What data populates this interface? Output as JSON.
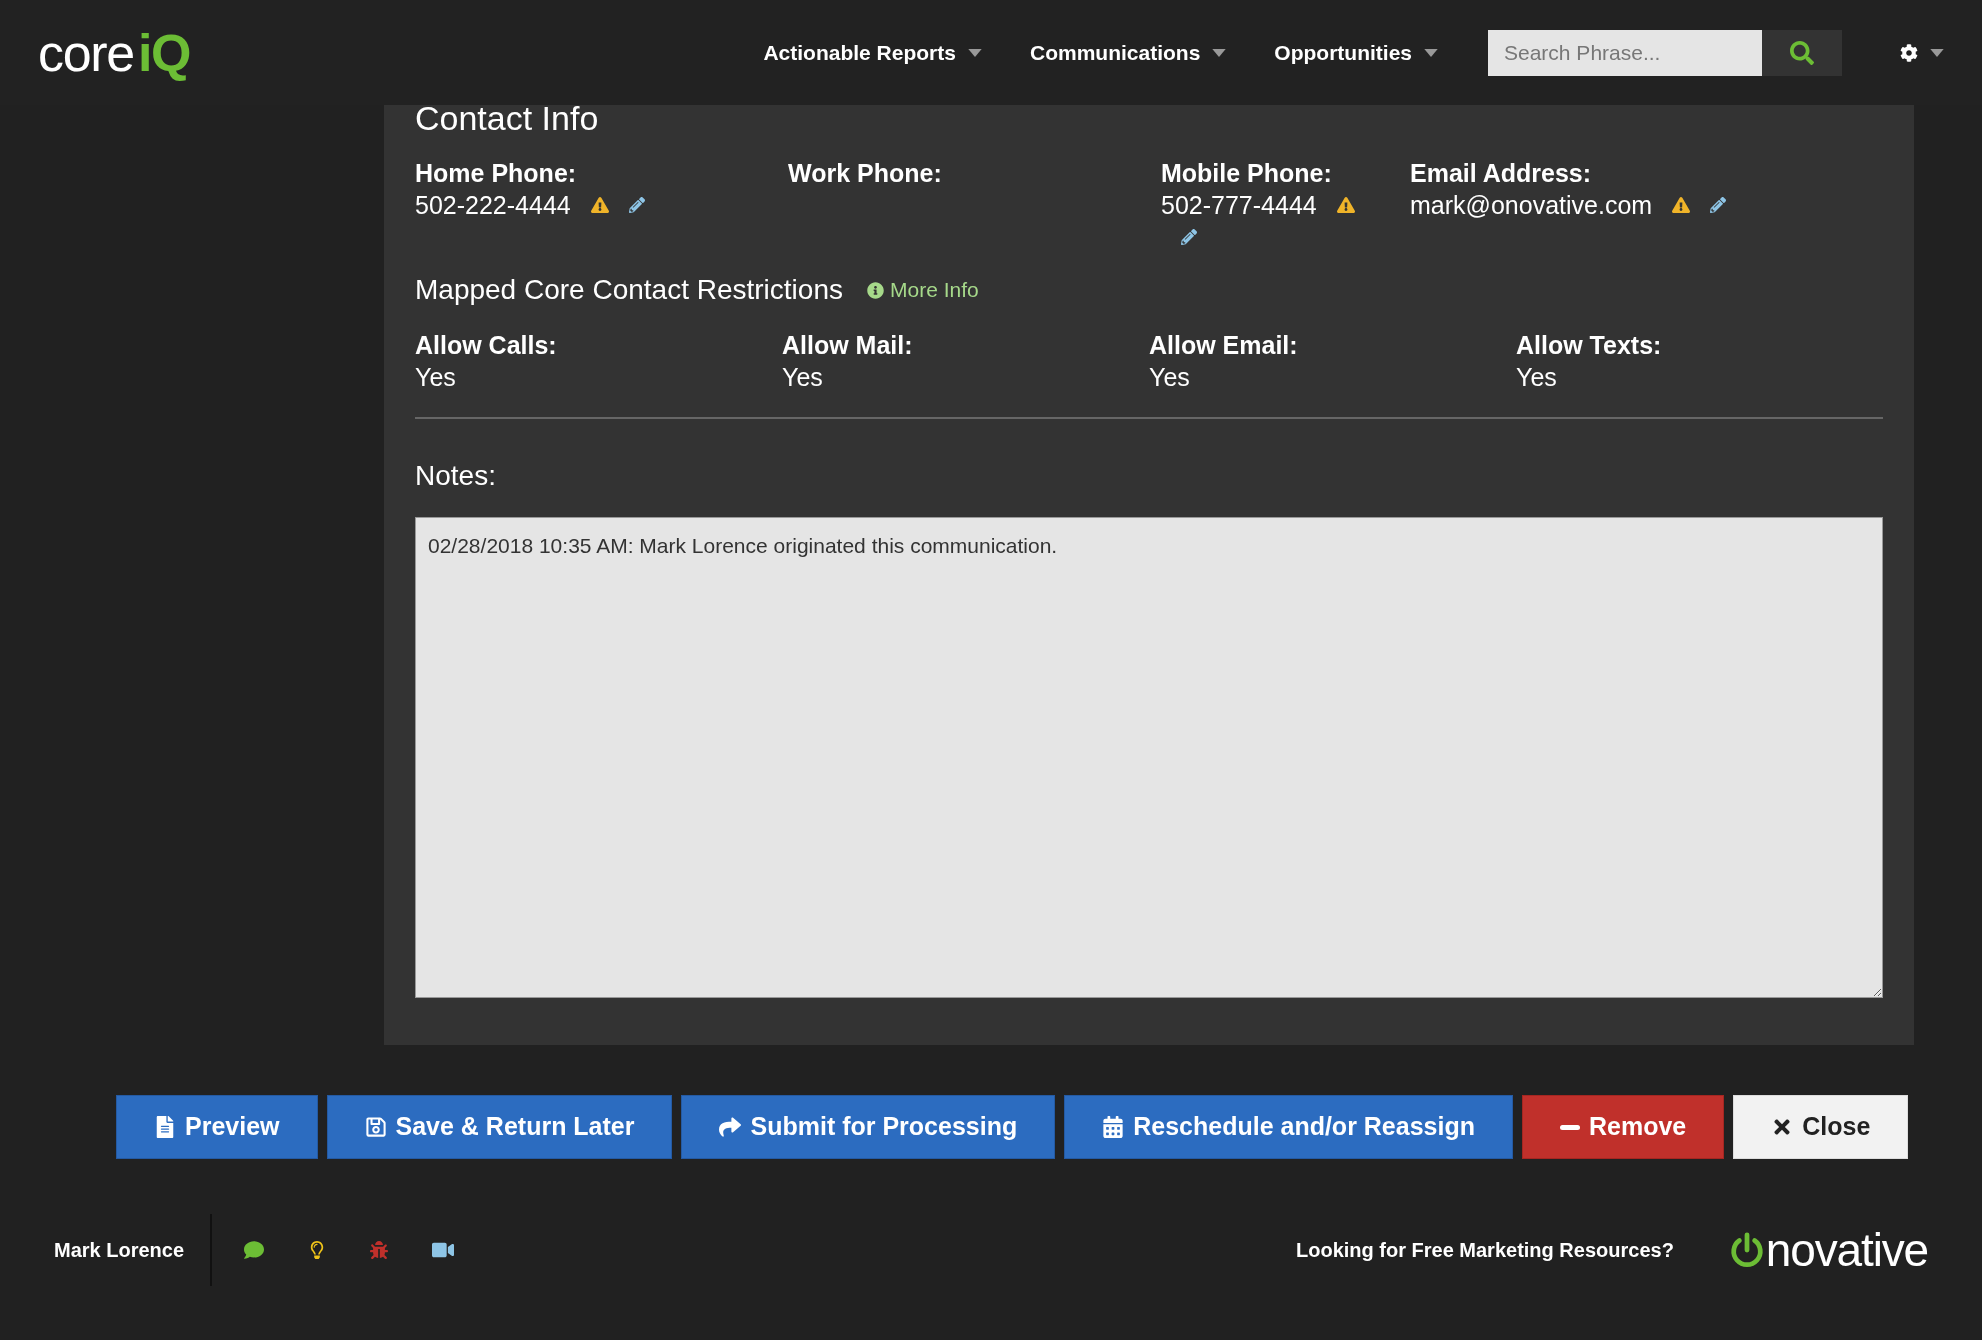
{
  "header": {
    "logo": {
      "core": "core",
      "iq": "iQ"
    },
    "nav": [
      {
        "label": "Actionable Reports"
      },
      {
        "label": "Communications"
      },
      {
        "label": "Opportunities"
      }
    ],
    "search": {
      "placeholder": "Search Phrase..."
    }
  },
  "contact_info": {
    "title": "Contact Info",
    "fields": [
      {
        "label": "Home Phone:",
        "value": "502-222-4444",
        "warning": true,
        "editable": true
      },
      {
        "label": "Work Phone:",
        "warning": false,
        "editable": false
      },
      {
        "label": "Mobile Phone:",
        "value": "502-777-4444",
        "warning": true,
        "editable": true
      },
      {
        "label": "Email Address:",
        "value": "mark@onovative.com",
        "warning": true,
        "editable": true
      }
    ],
    "restrictions_title": "Mapped Core Contact Restrictions",
    "more_info": "More Info",
    "restrictions": [
      {
        "label": "Allow Calls:",
        "value": "Yes"
      },
      {
        "label": "Allow Mail:",
        "value": "Yes"
      },
      {
        "label": "Allow Email:",
        "value": "Yes"
      },
      {
        "label": "Allow Texts:",
        "value": "Yes"
      }
    ],
    "notes_label": "Notes:",
    "notes_value": "02/28/2018 10:35 AM: Mark Lorence originated this communication."
  },
  "actions": [
    {
      "label": "Preview",
      "kind": "primary"
    },
    {
      "label": "Save & Return Later",
      "kind": "primary"
    },
    {
      "label": "Submit for Processing",
      "kind": "primary"
    },
    {
      "label": "Reschedule and/or Reassign",
      "kind": "primary"
    },
    {
      "label": "Remove",
      "kind": "danger"
    },
    {
      "label": "Close",
      "kind": "default"
    }
  ],
  "footer": {
    "user": "Mark Lorence",
    "promo": "Looking for Free Marketing Resources?",
    "brand": "novative"
  }
}
